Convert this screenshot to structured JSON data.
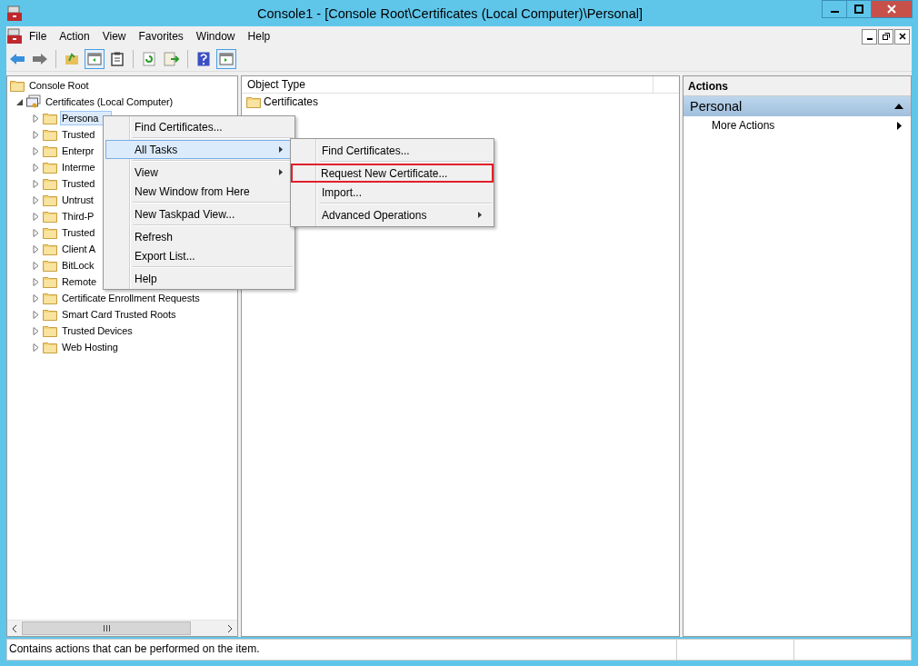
{
  "window": {
    "title": "Console1 - [Console Root\\Certificates (Local Computer)\\Personal]"
  },
  "menu_bar": [
    "File",
    "Action",
    "View",
    "Favorites",
    "Window",
    "Help"
  ],
  "tree": [
    {
      "label": "Console Root",
      "selected": false,
      "children": [
        {
          "label": "Certificates (Local Computer)",
          "expanded": true,
          "selected": false,
          "children": [
            {
              "label": "Persona",
              "expanded": false,
              "selected": true
            },
            {
              "label": "Trusted",
              "expanded": false,
              "selected": false
            },
            {
              "label": "Enterpr",
              "expanded": false,
              "selected": false
            },
            {
              "label": "Interme",
              "expanded": false,
              "selected": false
            },
            {
              "label": "Trusted",
              "expanded": false,
              "selected": false
            },
            {
              "label": "Untrust",
              "expanded": false,
              "selected": false
            },
            {
              "label": "Third-P",
              "expanded": false,
              "selected": false
            },
            {
              "label": "Trusted",
              "expanded": false,
              "selected": false
            },
            {
              "label": "Client A",
              "expanded": false,
              "selected": false
            },
            {
              "label": "BitLock",
              "expanded": false,
              "selected": false
            },
            {
              "label": "Remote",
              "expanded": false,
              "selected": false
            },
            {
              "label": "Certificate Enrollment Requests",
              "expanded": false,
              "selected": false
            },
            {
              "label": "Smart Card Trusted Roots",
              "expanded": false,
              "selected": false
            },
            {
              "label": "Trusted Devices",
              "expanded": false,
              "selected": false
            },
            {
              "label": "Web Hosting",
              "expanded": false,
              "selected": false
            }
          ]
        }
      ]
    }
  ],
  "list": {
    "columns": [
      "Object Type"
    ],
    "rows": [
      "Certificates"
    ]
  },
  "actions": {
    "header": "Actions",
    "section": "Personal",
    "items": [
      "More Actions"
    ]
  },
  "context_menu": [
    {
      "kind": "item",
      "label": "Find Certificates...",
      "selected": false
    },
    {
      "kind": "separator"
    },
    {
      "kind": "submenu",
      "label": "All Tasks",
      "selected": true
    },
    {
      "kind": "separator"
    },
    {
      "kind": "submenu",
      "label": "View",
      "selected": false
    },
    {
      "kind": "item",
      "label": "New Window from Here",
      "selected": false
    },
    {
      "kind": "separator"
    },
    {
      "kind": "item",
      "label": "New Taskpad View...",
      "selected": false
    },
    {
      "kind": "separator"
    },
    {
      "kind": "item",
      "label": "Refresh",
      "selected": false
    },
    {
      "kind": "item",
      "label": "Export List...",
      "selected": false
    },
    {
      "kind": "separator"
    },
    {
      "kind": "item",
      "label": "Help",
      "selected": false
    }
  ],
  "submenu": [
    {
      "kind": "item",
      "label": "Find Certificates...",
      "highlighted": false
    },
    {
      "kind": "separator"
    },
    {
      "kind": "item",
      "label": "Request New Certificate...",
      "highlighted": true
    },
    {
      "kind": "item",
      "label": "Import...",
      "highlighted": false
    },
    {
      "kind": "separator"
    },
    {
      "kind": "submenu",
      "label": "Advanced Operations",
      "highlighted": false
    }
  ],
  "status_bar": {
    "text": "Contains actions that can be performed on the item."
  }
}
